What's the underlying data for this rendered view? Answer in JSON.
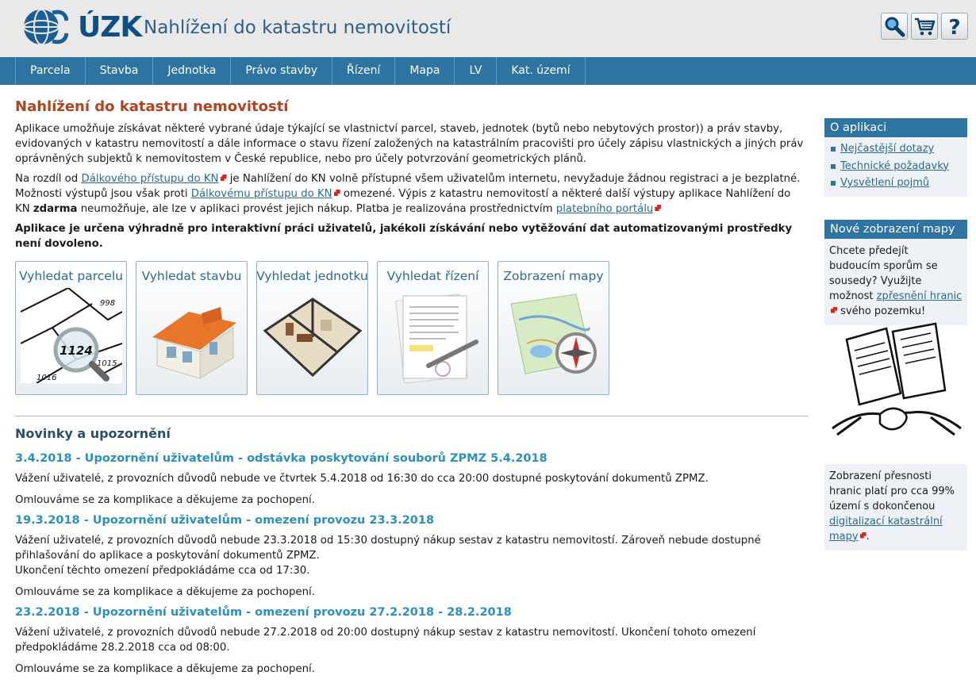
{
  "header": {
    "logo_text": "ÚZK",
    "app_title": "Nahlížení do katastru nemovitostí",
    "icons": [
      "search-icon",
      "cart-icon",
      "help-icon"
    ]
  },
  "nav": [
    "Parcela",
    "Stavba",
    "Jednotka",
    "Právo stavby",
    "Řízení",
    "Mapa",
    "LV",
    "Kat. území"
  ],
  "main": {
    "title": "Nahlížení do katastru nemovitostí",
    "intro": "Aplikace umožňuje získávat některé vybrané údaje týkající se vlastnictví parcel, staveb, jednotek (bytů nebo nebytových prostor)) a práv stavby, evidovaných v katastru nemovitostí a dále informace o stavu řízení založených na katastrálním pracovišti pro účely zápisu vlastnických a jiných práv oprávněných subjektů k nemovitostem v České republice, nebo pro účely potvrzování geometrických plánů.",
    "p2": {
      "t1": "Na rozdíl od ",
      "link1": "Dálkového přístupu do KN",
      "t2": " je Nahlížení do KN volně přístupné všem uživatelům internetu, nevyžaduje žádnou registraci a je bezplatné. Možnosti výstupů jsou však proti ",
      "link2": "Dálkovému přístupu do KN",
      "t3": " omezené. Výpis z katastru nemovitostí a některé další výstupy aplikace Nahlížení do KN ",
      "bold": "zdarma",
      "t4": " neumožňuje, ale lze v aplikaci provést jejich nákup. Platba je realizována prostřednictvím ",
      "link3": "platebního portálu"
    },
    "warning": "Aplikace je určena výhradně pro interaktivní práci uživatelů, jakékoli získávání nebo vytěžování dat automatizovanými prostředky není dovoleno.",
    "tiles": [
      {
        "label": "Vyhledat parcelu",
        "icon": "parcel-map-magnifier-icon",
        "parcel_numbers": [
          "998",
          "1124",
          "1015",
          "1016"
        ]
      },
      {
        "label": "Vyhledat stavbu",
        "icon": "house-icon"
      },
      {
        "label": "Vyhledat jednotku",
        "icon": "apartment-floorplan-icon"
      },
      {
        "label": "Vyhledat řízení",
        "icon": "document-pen-icon"
      },
      {
        "label": "Zobrazení mapy",
        "icon": "map-compass-icon"
      }
    ],
    "news_heading": "Novinky a upozornění",
    "news": [
      {
        "title": "3.4.2018 - Upozornění uživatelům - odstávka poskytování souborů ZPMZ 5.4.2018",
        "body": [
          "Vážení uživatelé, z provozních důvodů nebude ve čtvrtek 5.4.2018 od 16:30 do cca 20:00 dostupné poskytování dokumentů ZPMZ."
        ],
        "closing": "Omlouváme se za komplikace a děkujeme za pochopení."
      },
      {
        "title": "19.3.2018 - Upozornění uživatelům - omezení provozu 23.3.2018",
        "body": [
          "Vážení uživatelé, z provozních důvodů nebude 23.3.2018 od 15:30 dostupný nákup sestav z katastru nemovitostí. Zároveň nebude dostupné přihlašování do aplikace a poskytování dokumentů ZPMZ.",
          "Ukončení těchto omezení předpokládáme cca od 17:30."
        ],
        "closing": "Omlouváme se za komplikace a děkujeme za pochopení."
      },
      {
        "title": "23.2.2018 - Upozornění uživatelům - omezení provozu 27.2.2018 - 28.2.2018",
        "body": [
          "Vážení uživatelé, z provozních důvodů nebude 27.2.2018 od 20:00 dostupný nákup sestav z katastru nemovitostí. Ukončení tohoto omezení předpokládáme 28.2.2018 cca od 08:00."
        ],
        "closing": "Omlouváme se za komplikace a děkujeme za pochopení."
      }
    ]
  },
  "sidebar": {
    "about": {
      "title": "O aplikaci",
      "links": [
        "Nejčastější dotazy",
        "Technické požadavky",
        "Vysvětlení pojmů"
      ]
    },
    "map": {
      "title": "Nové zobrazení mapy",
      "text1": "Chcete předejít budoucím sporům se sousedy? Využijte možnost ",
      "link": "zpřesnění hranic",
      "text2": " svého pozemku!",
      "image_icon": "contract-handshake-icon"
    },
    "accuracy": {
      "text1": "Zobrazení přesnosti hranic platí pro cca 99% území s dokončenou ",
      "link": "digitalizací katastrální mapy",
      "text2": "."
    }
  },
  "colors": {
    "nav_bg": "#2e74a3",
    "title_orange": "#b0441d",
    "link_blue": "#2b6a93",
    "news_blue": "#2b8fbf"
  }
}
